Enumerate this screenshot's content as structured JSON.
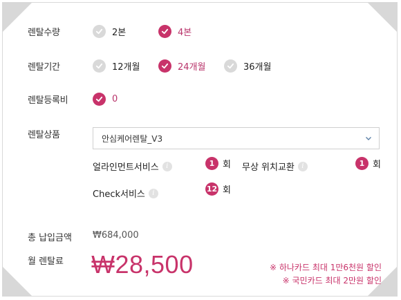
{
  "quantity": {
    "label": "렌탈수량",
    "options": [
      {
        "text": "2본",
        "selected": false
      },
      {
        "text": "4본",
        "selected": true
      }
    ]
  },
  "period": {
    "label": "렌탈기간",
    "options": [
      {
        "text": "12개월",
        "selected": false
      },
      {
        "text": "24개월",
        "selected": true
      },
      {
        "text": "36개월",
        "selected": false
      }
    ]
  },
  "registration_fee": {
    "label": "렌탈등록비",
    "options": [
      {
        "text": "0",
        "selected": true
      }
    ]
  },
  "product": {
    "label": "렌탈상품",
    "selected": "안심케어렌탈_V3"
  },
  "services": [
    {
      "name": "얼라인먼트서비스",
      "count": "1",
      "unit": "회"
    },
    {
      "name": "무상 위치교환",
      "count": "1",
      "unit": "회"
    },
    {
      "name": "Check서비스",
      "count": "12",
      "unit": "회"
    }
  ],
  "total": {
    "label": "총 납입금액",
    "value": "₩684,000"
  },
  "monthly": {
    "label": "월 렌탈료",
    "value": "₩28,500"
  },
  "discounts": [
    "※ 하나카드 최대 1만6천원 할인",
    "※ 국민카드 최대 2만원 할인"
  ],
  "icons": {
    "check": "check-icon",
    "info": "info-icon",
    "dropdown": "chevron-down-icon"
  },
  "colors": {
    "accent": "#c8336a",
    "unselected": "#d9d9d9"
  }
}
